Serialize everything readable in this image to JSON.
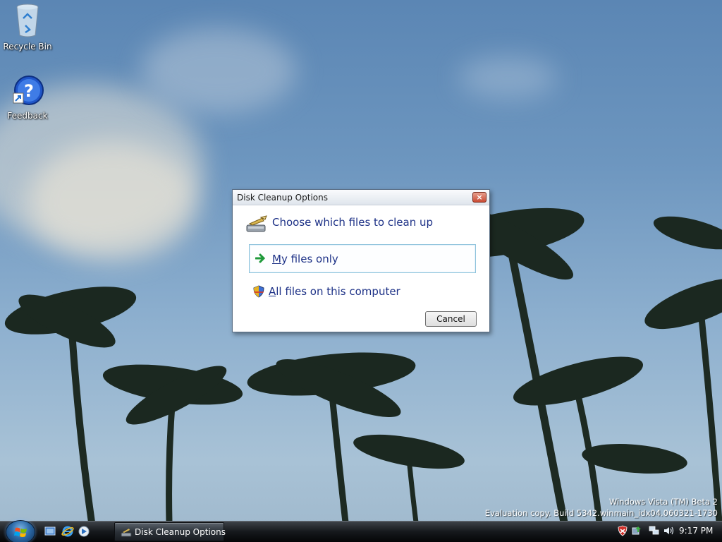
{
  "desktop": {
    "icons": [
      {
        "label": "Recycle Bin",
        "icon": "recycle-bin-icon"
      },
      {
        "label": "Feedback",
        "icon": "help-question-icon"
      }
    ],
    "watermark": {
      "line1": "Windows Vista (TM) Beta 2",
      "line2": "Evaluation copy. Build 5342.winmain_idx04.060321-1730"
    }
  },
  "dialog": {
    "title": "Disk Cleanup Options",
    "close_label": "×",
    "heading": "Choose which files to clean up",
    "options": [
      {
        "accel": "M",
        "rest": "y files only",
        "icon": "green-arrow-icon",
        "selected": true
      },
      {
        "accel": "A",
        "rest": "ll files on this computer",
        "icon": "uac-shield-icon",
        "selected": false
      }
    ],
    "cancel_label": "Cancel"
  },
  "taskbar": {
    "quick_launch": [
      "show-desktop-icon",
      "internet-explorer-icon",
      "switch-windows-icon"
    ],
    "window_button": "Disk Cleanup Options",
    "tray_icons": [
      "security-alert-icon",
      "update-icon",
      "network-icon",
      "volume-icon"
    ],
    "clock": "9:17 PM"
  },
  "colors": {
    "link_text": "#1e3287",
    "selected_border": "#8fc3dc",
    "taskbar": "#15181c"
  }
}
